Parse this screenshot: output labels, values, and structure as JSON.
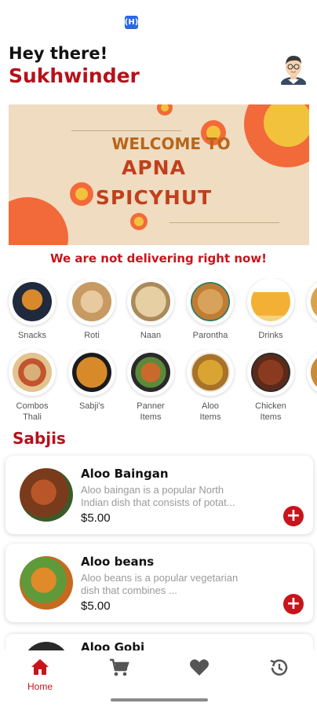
{
  "header": {
    "greeting": "Hey there!",
    "username": "Sukhwinder"
  },
  "banner": {
    "welcome": "WELCOME TO",
    "line1": "APNA",
    "line2": "SPICYHUT"
  },
  "notice": "We are not delivering right now!",
  "categories_row1": [
    {
      "label": "Snacks",
      "icon": "snacks-image"
    },
    {
      "label": "Roti",
      "icon": "roti-image"
    },
    {
      "label": "Naan",
      "icon": "naan-image"
    },
    {
      "label": "Parontha",
      "icon": "parontha-image"
    },
    {
      "label": "Drinks",
      "icon": "drinks-image"
    }
  ],
  "categories_row2": [
    {
      "label": "Combos\nThali",
      "icon": "thali-image"
    },
    {
      "label": "Sabji's",
      "icon": "sabji-image"
    },
    {
      "label": "Panner\nItems",
      "icon": "panner-image"
    },
    {
      "label": "Aloo\nItems",
      "icon": "aloo-image"
    },
    {
      "label": "Chicken\nItems",
      "icon": "chicken-image"
    }
  ],
  "section_title": "Sabjis",
  "items": [
    {
      "name": "Aloo Baingan",
      "description": "Aloo baingan is a popular North Indian dish that consists of potat...",
      "price": "$5.00"
    },
    {
      "name": "Aloo beans",
      "description": "Aloo beans is a popular vegetarian dish that combines ...",
      "price": "$5.00"
    },
    {
      "name": "Aloo Gobi"
    }
  ],
  "add_symbol": "+",
  "nav": {
    "home_label": "Home",
    "items": [
      "home-icon",
      "cart-icon",
      "heart-icon",
      "history-icon"
    ]
  },
  "colors": {
    "brand_red": "#b5121b",
    "accent_red": "#c8141c",
    "banner_bg": "#efdcc1",
    "banner_orange": "#f26a3a",
    "banner_yellow": "#f3c23d"
  }
}
